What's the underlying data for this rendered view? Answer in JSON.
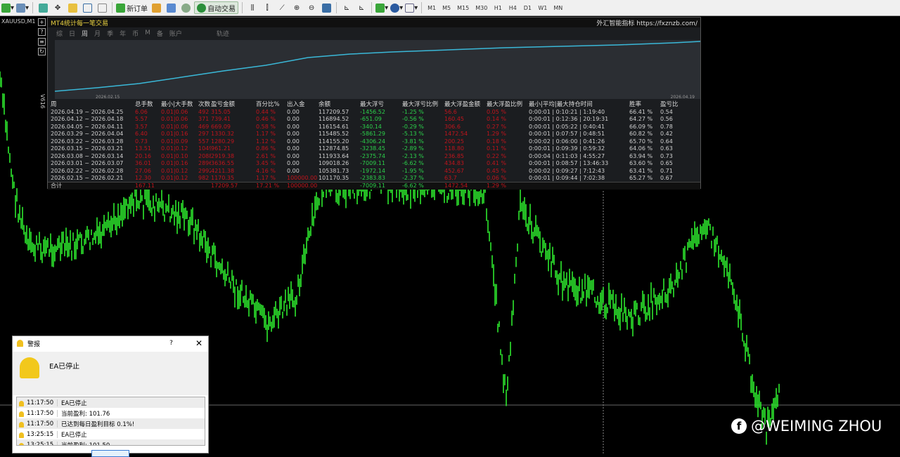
{
  "toolbar": {
    "new_order": "新订单",
    "auto_trade": "自动交易",
    "timeframes": [
      "M1",
      "M5",
      "M15",
      "M30",
      "H1",
      "H4",
      "D1",
      "W1",
      "MN"
    ]
  },
  "chart": {
    "symbol": "XAUUSD,M1",
    "side_label": "V616"
  },
  "panel": {
    "title": "MT4统计每一笔交易",
    "brand": "外汇智能指标 https://fxznzb.com/",
    "tabs": [
      "综",
      "日",
      "周",
      "月",
      "季",
      "年",
      "币",
      "M",
      "备",
      "账户",
      "轨迹"
    ],
    "active_tab": "周",
    "equity_start": "2026.02.15",
    "equity_end": "2026.04.19",
    "headers": [
      "周",
      "总手数",
      "最小|大手数",
      "次数",
      "盈亏金额",
      "百分比%",
      "出入金",
      "余额",
      "最大浮亏",
      "最大浮亏比例",
      "最大浮盈金额",
      "最大浮盈比例",
      "最小|平均|最大持仓时间",
      "胜率",
      "盈亏比"
    ],
    "rows": [
      [
        "2026.04.19 ~ 2026.04.25",
        "6.06",
        "0.01|0.06",
        "492",
        "315.05",
        "0.44 %",
        "0.00",
        "117209.57",
        "-1456.52",
        "-1.25 %",
        "56.6",
        "0.05 %",
        "0:00:01 | 0:10:21 | 1:19:40",
        "66.41 %",
        "0.54"
      ],
      [
        "2026.04.12 ~ 2026.04.18",
        "5.57",
        "0.01|0.06",
        "371",
        "739.41",
        "0.46 %",
        "0.00",
        "116894.52",
        "-651.09",
        "-0.56 %",
        "160.45",
        "0.14 %",
        "0:00:01 | 0:12:36 | 20:19:31",
        "64.27 %",
        "0.56"
      ],
      [
        "2026.04.05 ~ 2026.04.11",
        "3.57",
        "0.01|0.06",
        "469",
        "669.09",
        "0.58 %",
        "0.00",
        "116154.61",
        "-340.14",
        "-0.29 %",
        "306.6",
        "0.27 %",
        "0:00:01 | 0:05:22 | 0:40:41",
        "66.09 %",
        "0.78"
      ],
      [
        "2026.03.29 ~ 2026.04.04",
        "6.40",
        "0.01|0.16",
        "297",
        "1330.32",
        "1.17 %",
        "0.00",
        "115485.52",
        "-5861.29",
        "-5.13 %",
        "1472.54",
        "1.29 %",
        "0:00:01 | 0:07:57 | 0:48:51",
        "60.82 %",
        "0.42"
      ],
      [
        "2026.03.22 ~ 2026.03.28",
        "0.73",
        "0.01|0.09",
        "557",
        "1280.29",
        "1.12 %",
        "0.00",
        "114155.20",
        "-4306.24",
        "-3.81 %",
        "200.25",
        "0.18 %",
        "0:00:02 | 0:06:00 | 0:41:26",
        "65.70 %",
        "0.64"
      ],
      [
        "2026.03.15 ~ 2026.03.21",
        "13.51",
        "0.01|0.12",
        "1049",
        "961.21",
        "0.86 %",
        "0.00",
        "112874.85",
        "-3238.45",
        "-2.89 %",
        "118.80",
        "0.11 %",
        "0:00:01 | 0:09:39 | 0:59:32",
        "64.06 %",
        "0.63"
      ],
      [
        "2026.03.08 ~ 2026.03.14",
        "20.16",
        "0.01|0.10",
        "2088",
        "2919.38",
        "2.61 %",
        "0.00",
        "111933.64",
        "-2375.74",
        "-2.13 %",
        "236.85",
        "0.22 %",
        "0:00:04 | 0:11:03 | 4:55:27",
        "63.94 %",
        "0.73"
      ],
      [
        "2026.03.01 ~ 2026.03.07",
        "36.01",
        "0.01|0.16",
        "2896",
        "3636.55",
        "3.45 %",
        "0.00",
        "109018.26",
        "-7009.11",
        "-6.62 %",
        "434.83",
        "0.41 %",
        "0:00:01 | 0:08:57 | 13:46:33",
        "63.60 %",
        "0.65"
      ],
      [
        "2026.02.22 ~ 2026.02.28",
        "27.06",
        "0.01|0.12",
        "2992",
        "4211.38",
        "4.16 %",
        "0.00",
        "105381.73",
        "-1972.14",
        "-1.95 %",
        "452.67",
        "0.45 %",
        "0:00:02 | 0:09:27 | 7:12:43",
        "63.41 %",
        "0.71"
      ],
      [
        "2026.02.15 ~ 2026.02.21",
        "12.30",
        "0.01|0.12",
        "982",
        "1170.35",
        "1.17 %",
        "100000.00",
        "101170.35",
        "-2383.83",
        "-2.37 %",
        "63.7",
        "0.06 %",
        "0:00:01 | 0:09:44 | 7:02:38",
        "65.27 %",
        "0.67"
      ]
    ],
    "total": [
      "合计",
      "167.11",
      "",
      "",
      "17209.57",
      "17.21 %",
      "100000.00",
      "",
      "-7009.11",
      "-6.62 %",
      "1472.54",
      "1.29 %",
      "",
      "",
      ""
    ]
  },
  "alert": {
    "title": "警报",
    "help": "?",
    "close": "✕",
    "message": "EA已停止",
    "log": [
      [
        "11:17:50",
        "EA已停止"
      ],
      [
        "11:17:50",
        "当前盈利: 101.76"
      ],
      [
        "11:17:50",
        "已达到每日盈利目标 0.1%!"
      ],
      [
        "13:25:15",
        "EA已停止"
      ],
      [
        "13:25:15",
        "当前盈利: 101.50"
      ]
    ]
  },
  "watermark": {
    "text": "@WEIMING ZHOU"
  }
}
